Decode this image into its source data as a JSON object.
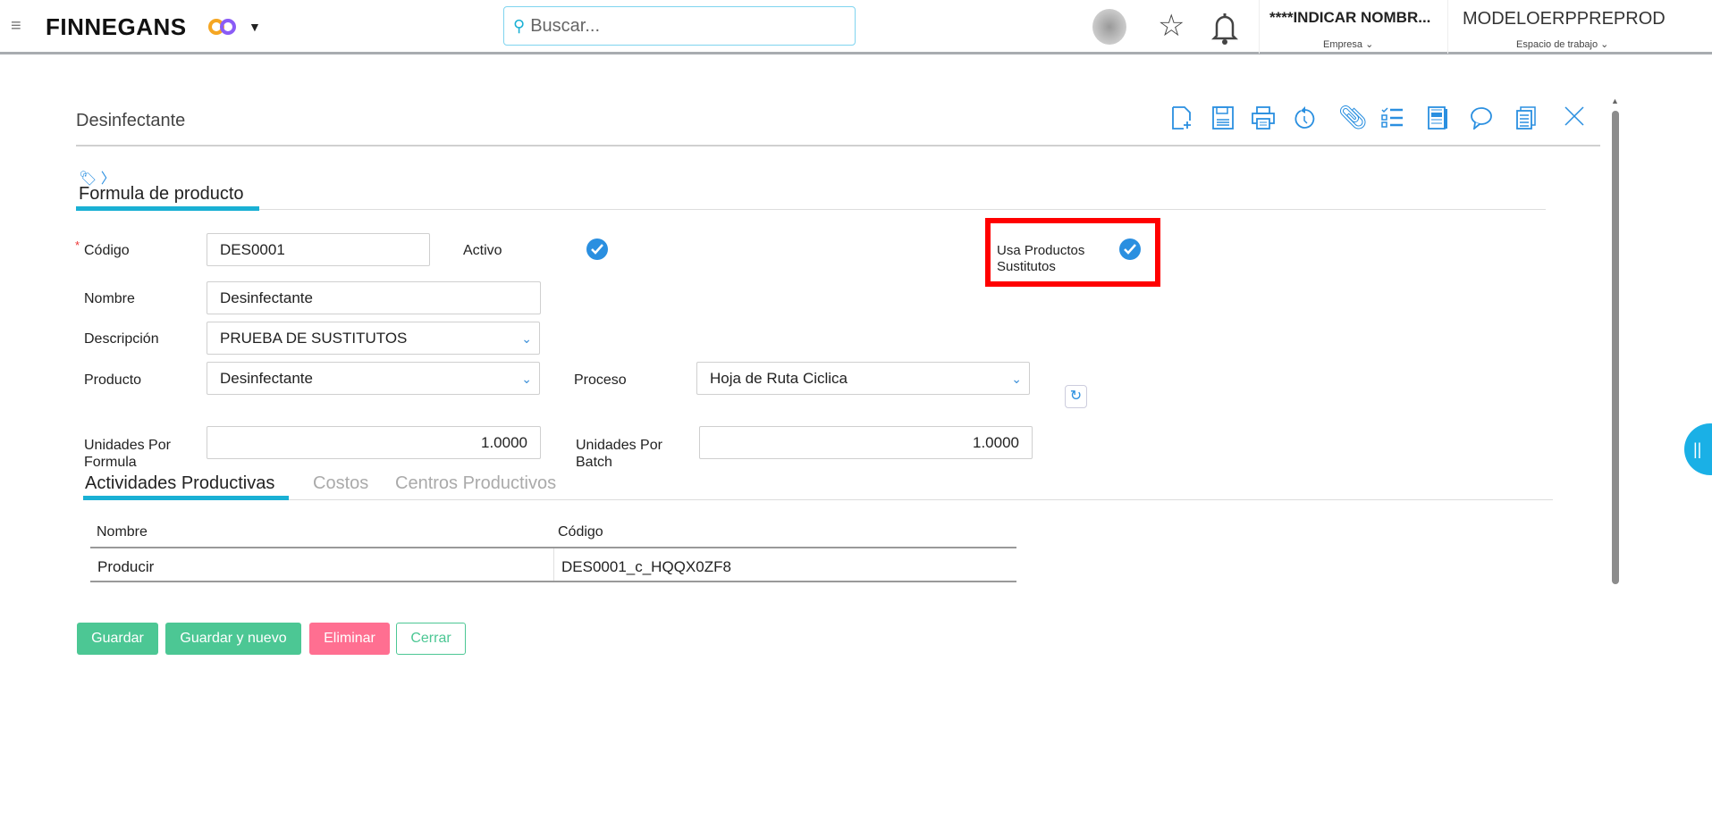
{
  "header": {
    "brand": "FINNEGANS",
    "search_placeholder": "Buscar...",
    "company": "****INDICAR NOMBR...",
    "company_label": "Empresa",
    "workspace": "MODELOERPPREPROD",
    "workspace_label": "Espacio de trabajo"
  },
  "page": {
    "title": "Desinfectante",
    "section": "Formula de producto"
  },
  "form": {
    "codigo_label": "Código",
    "codigo": "DES0001",
    "activo_label": "Activo",
    "usa_label_1": "Usa Productos",
    "usa_label_2": "Sustitutos",
    "nombre_label": "Nombre",
    "nombre": "Desinfectante",
    "descripcion_label": "Descripción",
    "descripcion": "PRUEBA DE SUSTITUTOS",
    "producto_label": "Producto",
    "producto": "Desinfectante",
    "proceso_label": "Proceso",
    "proceso": "Hoja de Ruta Ciclica",
    "upf_label_1": "Unidades Por",
    "upf_label_2": "Formula",
    "upf": "1.0000",
    "upb_label_1": "Unidades Por",
    "upb_label_2": "Batch",
    "upb": "1.0000"
  },
  "tabs": [
    "Actividades Productivas",
    "Costos",
    "Centros Productivos"
  ],
  "table": {
    "headers": [
      "Nombre",
      "Código"
    ],
    "rows": [
      [
        "Producir",
        "DES0001_c_HQQX0ZF8"
      ]
    ]
  },
  "buttons": {
    "guardar": "Guardar",
    "guardar_nuevo": "Guardar y nuevo",
    "eliminar": "Eliminar",
    "cerrar": "Cerrar"
  },
  "colors": {
    "accent": "#1ab0d4",
    "green": "#4cc794",
    "red": "#ff6f91",
    "highlight": "#ff0000"
  }
}
